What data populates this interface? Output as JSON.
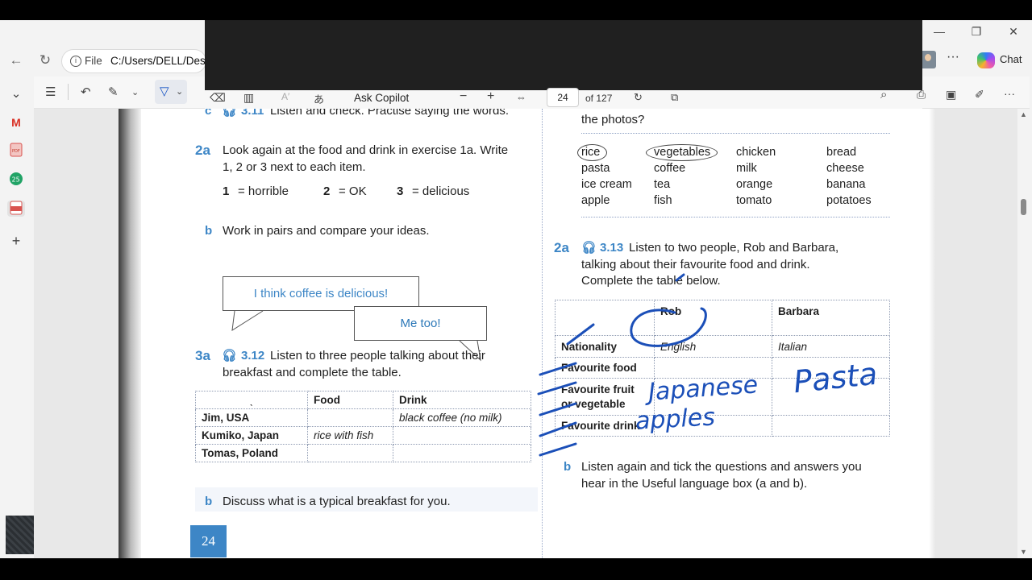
{
  "browser": {
    "window_controls": {
      "minimize": "—",
      "restore": "❐",
      "close": "✕"
    },
    "address": {
      "file_label": "File",
      "path": "C:/Users/DELL/Desk"
    },
    "chat_label": "Chat",
    "more": "···"
  },
  "pdf_toolbar": {
    "ask_copilot": "Ask Copilot",
    "zoom_out": "−",
    "zoom_in": "+",
    "page_current": "24",
    "page_total": "of 127",
    "font_icon_text": "A′"
  },
  "sidebar": {
    "icons": [
      "gmail-icon",
      "pdf-icon",
      "calendar-icon",
      "pdf-active-icon",
      "add-icon"
    ],
    "badge": "25"
  },
  "left_page": {
    "ex_1c": {
      "label": "c",
      "track": "3.11",
      "text": "Listen and check. Practise saying the words."
    },
    "ex_2a": {
      "num": "2a",
      "line1": "Look again at the food and drink in exercise 1a. Write",
      "line2": "1, 2 or 3 next to each item."
    },
    "scale": [
      {
        "n": "1",
        "word": "= horrible"
      },
      {
        "n": "2",
        "word": "= OK"
      },
      {
        "n": "3",
        "word": "= delicious"
      }
    ],
    "ex_2b": {
      "label": "b",
      "text": "Work in pairs and compare your ideas."
    },
    "bubble1": "I think coffee is delicious!",
    "bubble2": "Me too!",
    "ex_3a": {
      "num": "3a",
      "track": "3.12",
      "line1": "Listen to three people talking about their",
      "line2": "breakfast and complete the table."
    },
    "table": {
      "headers": [
        "ˎ",
        "Food",
        "Drink"
      ],
      "rows": [
        [
          "Jim, USA",
          "",
          "black coffee (no milk)"
        ],
        [
          "Kumiko, Japan",
          "rice with fish",
          ""
        ],
        [
          "Tomas, Poland",
          "",
          ""
        ]
      ]
    },
    "ex_3b": {
      "label": "b",
      "text": "Discuss what is a typical breakfast for you."
    },
    "page_number": "24"
  },
  "right_page": {
    "top_text": "the photos?",
    "food_grid": [
      [
        "rice",
        "vegetables",
        "chicken",
        "bread"
      ],
      [
        "pasta",
        "coffee",
        "milk",
        "cheese"
      ],
      [
        "ice cream",
        "tea",
        "orange",
        "banana"
      ],
      [
        "apple",
        "fish",
        "tomato",
        "potatoes"
      ]
    ],
    "ex_2a": {
      "num": "2a",
      "track": "3.13",
      "line1": "Listen to two people, Rob and Barbara,",
      "line2": "talking about their favourite food and drink.",
      "line3": "Complete the table below."
    },
    "table": {
      "headers": [
        "",
        "Rob",
        "Barbara"
      ],
      "rows": [
        [
          "Nationality",
          "English",
          "Italian"
        ],
        [
          "Favourite food",
          "",
          ""
        ],
        [
          "Favourite fruit\nor vegetable",
          "",
          ""
        ],
        [
          "Favourite drink",
          "",
          ""
        ]
      ]
    },
    "ex_2b": {
      "label": "b",
      "line1": "Listen again and tick the questions and answers you",
      "line2": "hear in the Useful language box (a and b)."
    }
  },
  "annotations": {
    "ink_food": "Japanese",
    "ink_fruit": "apples",
    "ink_barbara_food": "Pasta"
  }
}
